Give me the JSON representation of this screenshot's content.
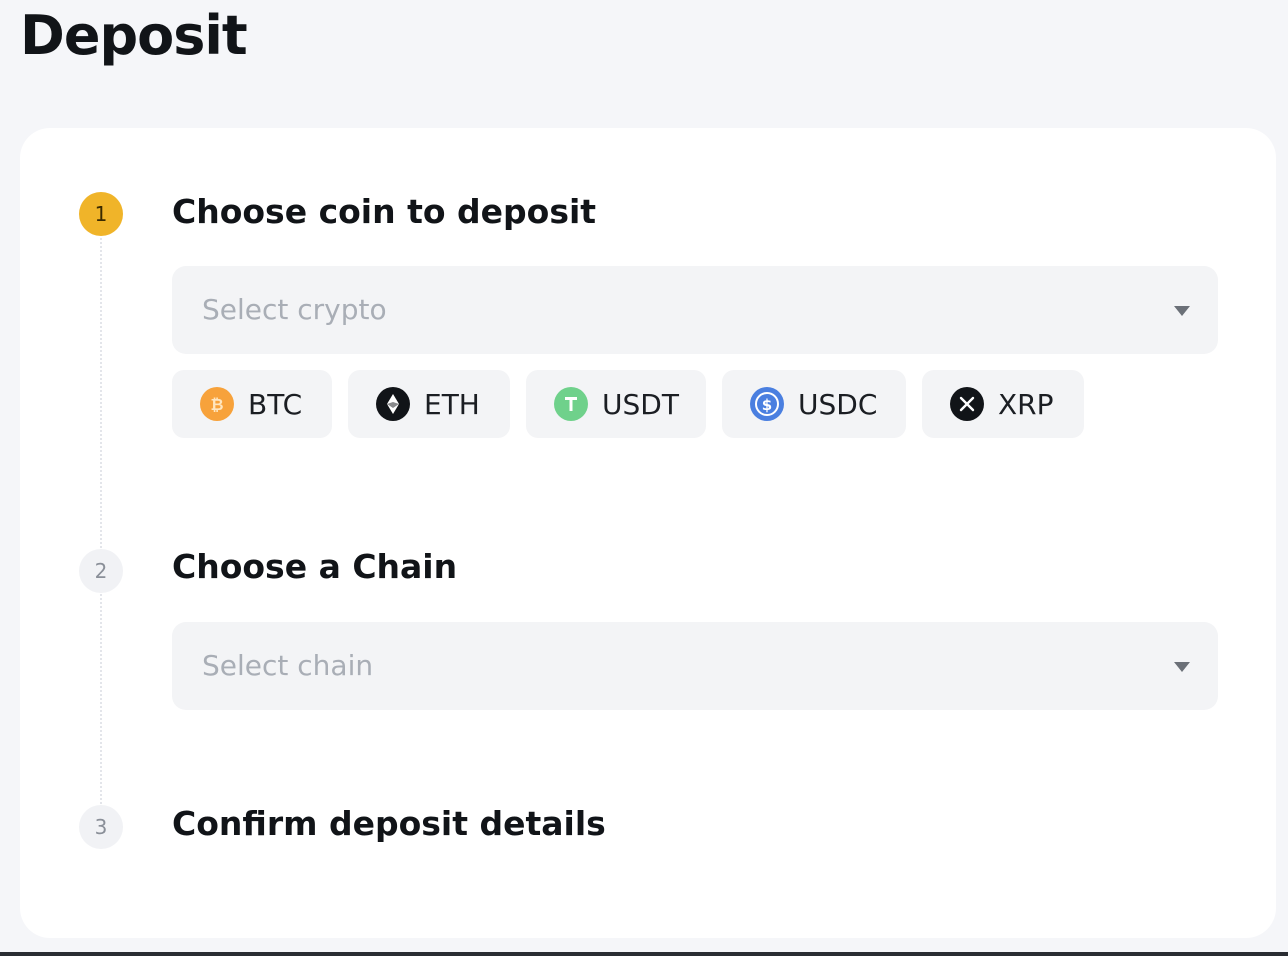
{
  "page": {
    "title": "Deposit"
  },
  "steps": [
    {
      "number": "1",
      "title": "Choose coin to deposit",
      "state": "active"
    },
    {
      "number": "2",
      "title": "Choose a Chain",
      "state": "inactive"
    },
    {
      "number": "3",
      "title": "Confirm deposit details",
      "state": "inactive"
    }
  ],
  "crypto_select": {
    "placeholder": "Select crypto",
    "icon": "caret-down-icon"
  },
  "chain_select": {
    "placeholder": "Select chain",
    "icon": "caret-down-icon"
  },
  "coins": [
    {
      "label": "BTC",
      "icon": "btc-icon",
      "color": "#f7a23b"
    },
    {
      "label": "ETH",
      "icon": "eth-icon",
      "color": "#111418"
    },
    {
      "label": "USDT",
      "icon": "usdt-icon",
      "color": "#6fd18b"
    },
    {
      "label": "USDC",
      "icon": "usdc-icon",
      "color": "#4a7fe0"
    },
    {
      "label": "XRP",
      "icon": "xrp-icon",
      "color": "#111418"
    }
  ],
  "colors": {
    "accent": "#f0b429",
    "background": "#f5f6f9",
    "card": "#ffffff"
  }
}
